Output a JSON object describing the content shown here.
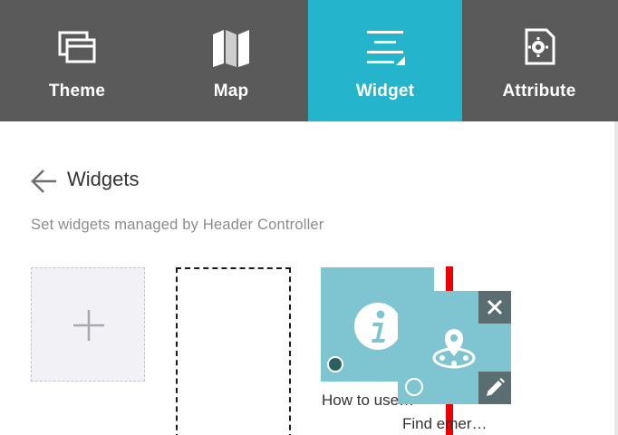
{
  "tabs": [
    {
      "label": "Theme",
      "icon": "theme-icon",
      "active": false
    },
    {
      "label": "Map",
      "icon": "map-icon",
      "active": false
    },
    {
      "label": "Widget",
      "icon": "widget-icon",
      "active": true
    },
    {
      "label": "Attribute",
      "icon": "attribute-icon",
      "active": false
    }
  ],
  "header": {
    "title": "Widgets",
    "subtitle": "Set widgets managed by Header Controller",
    "back_icon": "arrow-left-icon"
  },
  "tiles": {
    "add_icon": "plus-icon",
    "widgets": [
      {
        "label": "How to use…",
        "icon": "info-icon",
        "selected": true
      },
      {
        "label": "Find emer…",
        "icon": "location-pin-icon",
        "selected": false
      }
    ]
  },
  "colors": {
    "tabbar": "#5a5a5a",
    "active_tab": "#24b5cc",
    "tile": "#7fc5d1",
    "drag_indicator": "#ee0000"
  }
}
